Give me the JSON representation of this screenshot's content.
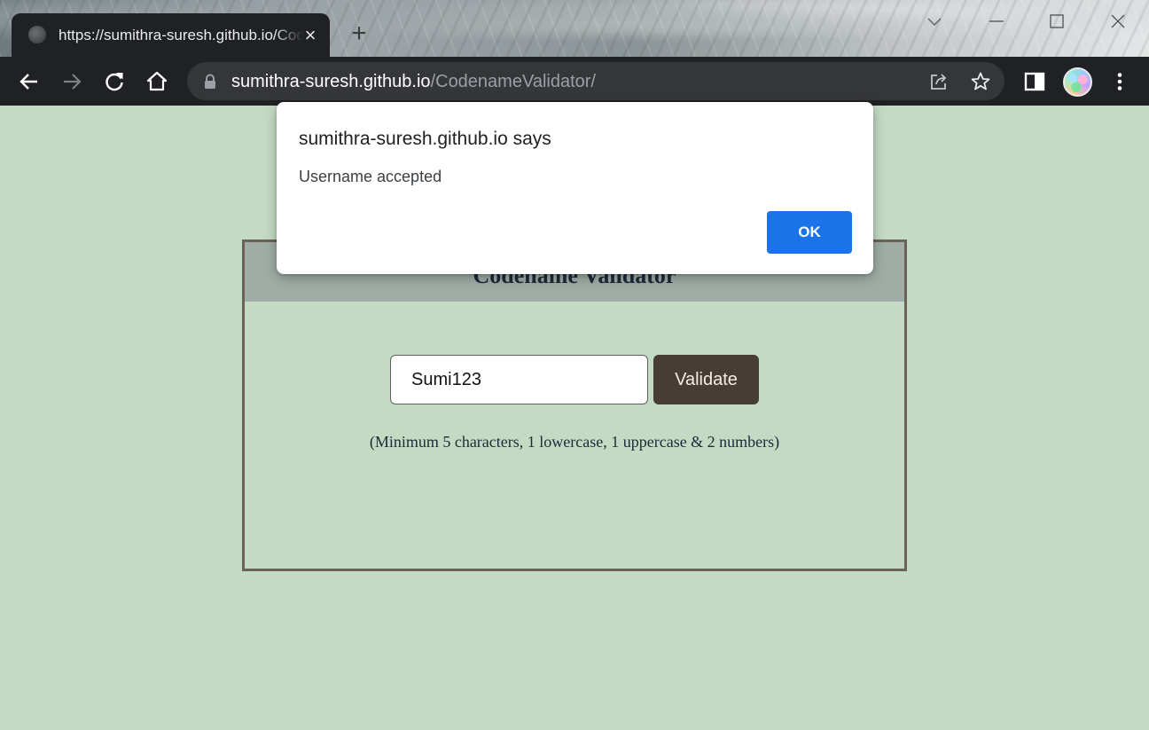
{
  "browser": {
    "tab": {
      "title": "https://sumithra-suresh.github.io/CodenameValidator/",
      "close_label": "×",
      "favicon": "globe-icon"
    },
    "new_tab_label": "+",
    "address_bar": {
      "host": "sumithra-suresh.github.io",
      "path": "/CodenameValidator/"
    },
    "toolbar_icons": [
      "back-icon",
      "forward-icon",
      "reload-icon",
      "home-icon",
      "lock-icon",
      "share-icon",
      "star-icon",
      "side-panel-icon",
      "avatar",
      "menu-icon"
    ],
    "window_controls": [
      "tab-search-icon",
      "minimize-icon",
      "maximize-icon",
      "close-icon"
    ]
  },
  "page": {
    "title": "Codename Validator",
    "input": {
      "value": "Sumi123"
    },
    "validate_label": "Validate",
    "hint": "(Minimum 5 characters, 1 lowercase, 1 uppercase & 2 numbers)",
    "colors": {
      "background": "#c3dbc3",
      "header": "#9fada6",
      "button": "#483c36",
      "border": "#6b6257"
    }
  },
  "dialog": {
    "title": "sumithra-suresh.github.io says",
    "message": "Username accepted",
    "ok_label": "OK",
    "ok_color": "#1a73e8"
  }
}
